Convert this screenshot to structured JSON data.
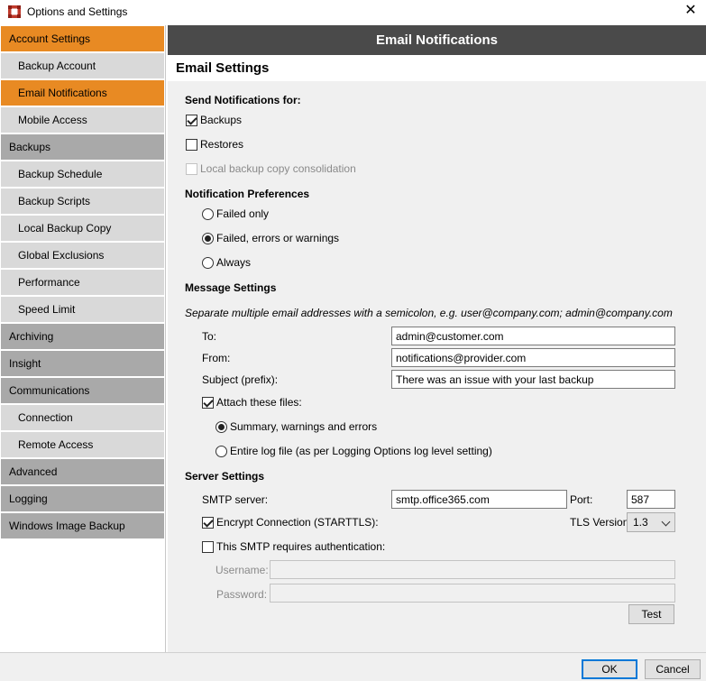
{
  "window": {
    "title": "Options and Settings"
  },
  "sidebar": {
    "items": [
      {
        "label": "Account Settings",
        "level": "top",
        "active": true
      },
      {
        "label": "Backup Account",
        "level": "sub",
        "active": false
      },
      {
        "label": "Email Notifications",
        "level": "sub",
        "active": true
      },
      {
        "label": "Mobile Access",
        "level": "sub",
        "active": false
      },
      {
        "label": "Backups",
        "level": "top",
        "active": false
      },
      {
        "label": "Backup Schedule",
        "level": "sub",
        "active": false
      },
      {
        "label": "Backup Scripts",
        "level": "sub",
        "active": false
      },
      {
        "label": "Local Backup Copy",
        "level": "sub",
        "active": false
      },
      {
        "label": "Global Exclusions",
        "level": "sub",
        "active": false
      },
      {
        "label": "Performance",
        "level": "sub",
        "active": false
      },
      {
        "label": "Speed Limit",
        "level": "sub",
        "active": false
      },
      {
        "label": "Archiving",
        "level": "top",
        "active": false
      },
      {
        "label": "Insight",
        "level": "top",
        "active": false
      },
      {
        "label": "Communications",
        "level": "top",
        "active": false
      },
      {
        "label": "Connection",
        "level": "sub",
        "active": false
      },
      {
        "label": "Remote Access",
        "level": "sub",
        "active": false
      },
      {
        "label": "Advanced",
        "level": "top",
        "active": false
      },
      {
        "label": "Logging",
        "level": "top",
        "active": false
      },
      {
        "label": "Windows Image Backup",
        "level": "top",
        "active": false
      }
    ]
  },
  "panel": {
    "header": "Email Notifications",
    "subtitle": "Email Settings",
    "send_for": {
      "heading": "Send Notifications for:",
      "backups": {
        "label": "Backups",
        "checked": true
      },
      "restores": {
        "label": "Restores",
        "checked": false
      },
      "local_copy": {
        "label": "Local backup copy consolidation",
        "checked": false,
        "disabled": true
      }
    },
    "preferences": {
      "heading": "Notification Preferences",
      "options": [
        "Failed only",
        "Failed, errors or warnings",
        "Always"
      ],
      "selected": "Failed, errors or warnings"
    },
    "message": {
      "heading": "Message Settings",
      "hint": "Separate multiple email addresses with a semicolon, e.g. user@company.com; admin@company.com",
      "to_label": "To:",
      "to_value": "admin@customer.com",
      "from_label": "From:",
      "from_value": "notifications@provider.com",
      "subject_label": "Subject (prefix):",
      "subject_value": "There was an issue with your last backup",
      "attach_label": "Attach these files:",
      "attach_checked": true,
      "attach_options": [
        "Summary, warnings and errors",
        "Entire log file (as per Logging Options log level setting)"
      ],
      "attach_selected": "Summary, warnings and errors"
    },
    "server": {
      "heading": "Server Settings",
      "smtp_label": "SMTP server:",
      "smtp_value": "smtp.office365.com",
      "port_label": "Port:",
      "port_value": "587",
      "encrypt_label": "Encrypt Connection (STARTTLS):",
      "encrypt_checked": true,
      "tls_label": "TLS Version:",
      "tls_value": "1.3",
      "auth_label": "This SMTP requires authentication:",
      "auth_checked": false,
      "username_label": "Username:",
      "username_value": "",
      "password_label": "Password:",
      "password_value": "",
      "test_label": "Test"
    }
  },
  "footer": {
    "ok_label": "OK",
    "cancel_label": "Cancel"
  },
  "colors": {
    "accent": "#e88a23",
    "header_bg": "#4a4a4a",
    "nav_top": "#a9a9a9",
    "nav_sub": "#d9d9d9",
    "body_bg": "#f0f0f0"
  },
  "icons": {
    "app": "app-logo-icon",
    "close": "close-icon",
    "dropdown": "chevron-down-icon"
  }
}
